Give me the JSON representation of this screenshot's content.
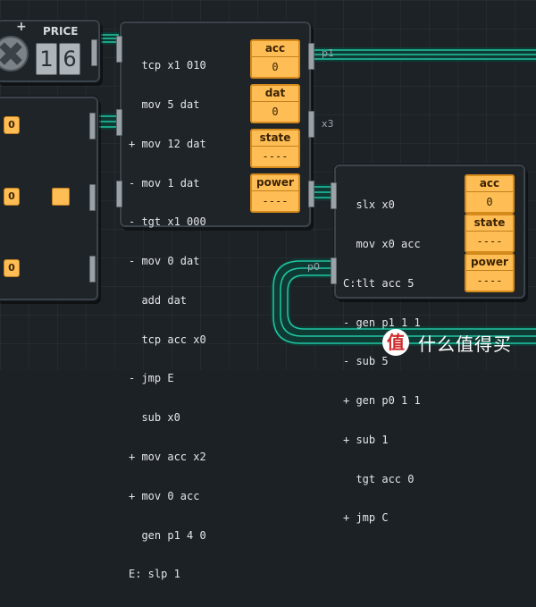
{
  "price_widget": {
    "label": "PRICE",
    "plus_symbol": "+",
    "digits": [
      "1",
      "6"
    ]
  },
  "controller_a": {
    "code": [
      "  tcp x1 010",
      "  mov 5 dat",
      "+ mov 12 dat",
      "- mov 1 dat",
      "- tgt x1 000",
      "- mov 0 dat",
      "  add dat",
      "  tcp acc x0",
      "- jmp E",
      "  sub x0",
      "+ mov acc x2",
      "+ mov 0 acc",
      "  gen p1 4 0",
      "E: slp 1"
    ],
    "registers": [
      {
        "label": "acc",
        "value": "0"
      },
      {
        "label": "dat",
        "value": "0"
      },
      {
        "label": "state",
        "value": "----"
      },
      {
        "label": "power",
        "value": "----"
      }
    ]
  },
  "controller_b": {
    "code": [
      "  slx x0",
      "  mov x0 acc",
      "C:tlt acc 5",
      "- gen p1 1 1",
      "- sub 5",
      "+ gen p0 1 1",
      "+ sub 1",
      "  tgt acc 0",
      "+ jmp C"
    ],
    "registers": [
      {
        "label": "acc",
        "value": "0"
      },
      {
        "label": "state",
        "value": "----"
      },
      {
        "label": "power",
        "value": "----"
      }
    ]
  },
  "selector_module": {
    "chips": [
      "0",
      "0",
      "0"
    ]
  },
  "pin_labels": {
    "p1": "p1",
    "x3": "x3",
    "p0": "p0"
  },
  "watermark": {
    "icon_text": "值",
    "text": "什么值得买"
  },
  "colors": {
    "background": "#1d2227",
    "wire_teal": "#22c6a3",
    "wire_orange": "#ffa53a",
    "register_fill": "#ffbe55",
    "module_border": "#3b434b"
  }
}
